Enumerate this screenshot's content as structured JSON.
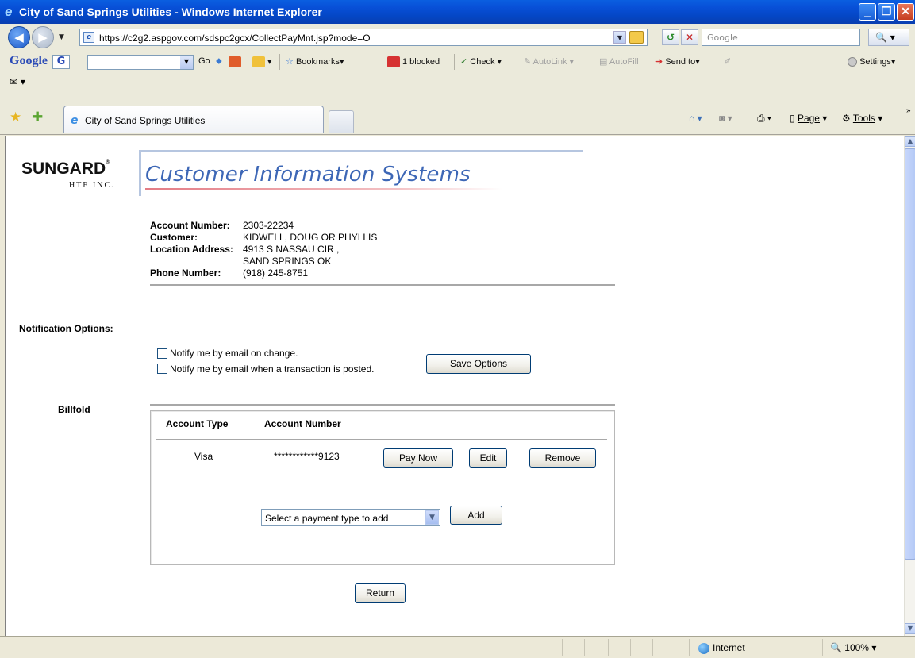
{
  "window": {
    "title": "City of Sand Springs Utilities - Windows Internet Explorer",
    "minimize": "_",
    "maximize": "❐",
    "close": "✕"
  },
  "address_bar": {
    "url": "https://c2g2.aspgov.com/sdspc2gcx/CollectPayMnt.jsp?mode=O",
    "search_placeholder": "Google"
  },
  "google_toolbar": {
    "brand": "Google",
    "g_button": "G",
    "go": "Go",
    "bookmarks": "Bookmarks",
    "blocked": "1 blocked",
    "check": "Check",
    "autolink": "AutoLink",
    "autofill": "AutoFill",
    "send_to": "Send to",
    "settings": "Settings"
  },
  "tabs": [
    {
      "label": "City of Sand Springs Utilities"
    }
  ],
  "command_bar": {
    "page": "Page",
    "tools": "Tools"
  },
  "logo": {
    "company": "SUNGARD",
    "subtitle": "HTE INC.",
    "registered": "®"
  },
  "banner": {
    "title": "Customer Information Systems"
  },
  "account": {
    "labels": {
      "account_number": "Account Number:",
      "customer": "Customer:",
      "location_address": "Location Address:",
      "phone_number": "Phone Number:"
    },
    "account_number": "2303-22234",
    "customer": "KIDWELL, DOUG OR PHYLLIS",
    "address_line1": "4913 S NASSAU CIR ,",
    "address_line2": "SAND SPRINGS OK",
    "phone_number": "(918) 245-8751"
  },
  "notifications": {
    "heading": "Notification Options:",
    "option_change": "Notify me by email on change.",
    "option_posted": "Notify me by email when a transaction is posted.",
    "option_change_checked": false,
    "option_posted_checked": false,
    "save_button": "Save Options"
  },
  "billfold": {
    "heading": "Billfold",
    "columns": [
      "Account Type",
      "Account Number"
    ],
    "rows": [
      {
        "type": "Visa",
        "number": "************9123",
        "pay_now": "Pay Now",
        "edit": "Edit",
        "remove": "Remove"
      }
    ],
    "payment_select": "Select a payment type to add",
    "add_button": "Add"
  },
  "return_button": "Return",
  "status_bar": {
    "zone": "Internet",
    "zoom": "100%"
  }
}
